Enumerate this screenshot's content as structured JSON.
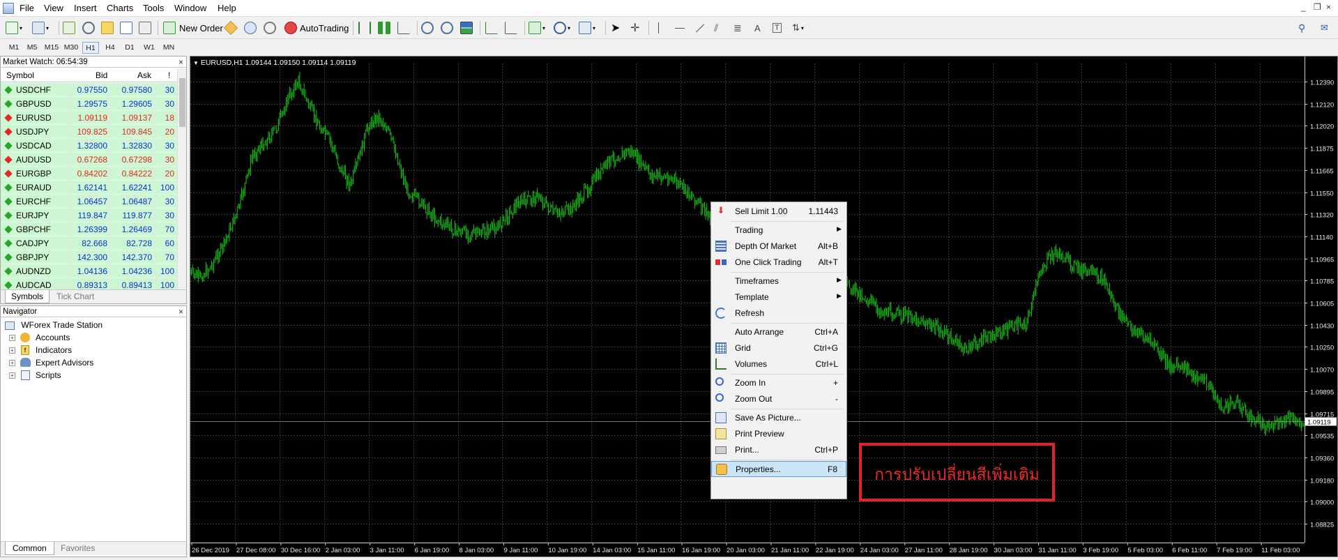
{
  "menubar": {
    "items": [
      "File",
      "View",
      "Insert",
      "Charts",
      "Tools",
      "Window",
      "Help"
    ],
    "window_controls": [
      "_",
      "❐",
      "×"
    ]
  },
  "toolbar": {
    "new_order": "New Order",
    "autotrading": "AutoTrading"
  },
  "timeframes": {
    "items": [
      "M1",
      "M5",
      "M15",
      "M30",
      "H1",
      "H4",
      "D1",
      "W1",
      "MN"
    ],
    "active": "H1"
  },
  "market_watch": {
    "title": "Market Watch: 06:54:39",
    "columns": [
      "Symbol",
      "Bid",
      "Ask",
      "!"
    ],
    "rows": [
      {
        "symbol": "USDCHF",
        "bid": "0.97550",
        "ask": "0.97580",
        "spread": "30",
        "dir": "up"
      },
      {
        "symbol": "GBPUSD",
        "bid": "1.29575",
        "ask": "1.29605",
        "spread": "30",
        "dir": "up"
      },
      {
        "symbol": "EURUSD",
        "bid": "1.09119",
        "ask": "1.09137",
        "spread": "18",
        "dir": "down"
      },
      {
        "symbol": "USDJPY",
        "bid": "109.825",
        "ask": "109.845",
        "spread": "20",
        "dir": "down"
      },
      {
        "symbol": "USDCAD",
        "bid": "1.32800",
        "ask": "1.32830",
        "spread": "30",
        "dir": "up"
      },
      {
        "symbol": "AUDUSD",
        "bid": "0.67268",
        "ask": "0.67298",
        "spread": "30",
        "dir": "down"
      },
      {
        "symbol": "EURGBP",
        "bid": "0.84202",
        "ask": "0.84222",
        "spread": "20",
        "dir": "down"
      },
      {
        "symbol": "EURAUD",
        "bid": "1.62141",
        "ask": "1.62241",
        "spread": "100",
        "dir": "up"
      },
      {
        "symbol": "EURCHF",
        "bid": "1.06457",
        "ask": "1.06487",
        "spread": "30",
        "dir": "up"
      },
      {
        "symbol": "EURJPY",
        "bid": "119.847",
        "ask": "119.877",
        "spread": "30",
        "dir": "up"
      },
      {
        "symbol": "GBPCHF",
        "bid": "1.26399",
        "ask": "1.26469",
        "spread": "70",
        "dir": "up"
      },
      {
        "symbol": "CADJPY",
        "bid": "82.668",
        "ask": "82.728",
        "spread": "60",
        "dir": "up"
      },
      {
        "symbol": "GBPJPY",
        "bid": "142.300",
        "ask": "142.370",
        "spread": "70",
        "dir": "up"
      },
      {
        "symbol": "AUDNZD",
        "bid": "1.04136",
        "ask": "1.04236",
        "spread": "100",
        "dir": "up"
      },
      {
        "symbol": "AUDCAD",
        "bid": "0.89313",
        "ask": "0.89413",
        "spread": "100",
        "dir": "up"
      }
    ],
    "tabs": [
      "Symbols",
      "Tick Chart"
    ]
  },
  "navigator": {
    "title": "Navigator",
    "root": "WForex Trade Station",
    "items": [
      "Accounts",
      "Indicators",
      "Expert Advisors",
      "Scripts"
    ],
    "tabs": [
      "Common",
      "Favorites"
    ]
  },
  "chart": {
    "header": "EURUSD,H1  1.09144 1.09150 1.09114 1.09119",
    "current_price": "1.09119",
    "price_labels": [
      "1.12390",
      "1.12120",
      "1.12020",
      "1.11875",
      "1.11665",
      "1.11550",
      "1.11320",
      "1.11140",
      "1.10965",
      "1.10785",
      "1.10605",
      "1.10430",
      "1.10250",
      "1.10070",
      "1.09895",
      "1.09715",
      "1.09535",
      "1.09360",
      "1.09180",
      "1.09000",
      "1.08825"
    ],
    "time_labels": [
      "26 Dec 2019",
      "27 Dec 08:00",
      "30 Dec 16:00",
      "2 Jan 03:00",
      "3 Jan 11:00",
      "6 Jan 19:00",
      "8 Jan 03:00",
      "9 Jan 11:00",
      "10 Jan 19:00",
      "14 Jan 03:00",
      "15 Jan 11:00",
      "16 Jan 19:00",
      "20 Jan 03:00",
      "21 Jan 11:00",
      "22 Jan 19:00",
      "24 Jan 03:00",
      "27 Jan 11:00",
      "28 Jan 19:00",
      "30 Jan 03:00",
      "31 Jan 11:00",
      "3 Feb 19:00",
      "5 Feb 03:00",
      "6 Feb 11:00",
      "7 Feb 19:00",
      "11 Feb 03:00"
    ],
    "line_color": "#18c718",
    "grid_color": "#3a3a3a"
  },
  "context_menu": {
    "items": [
      {
        "label": "Sell Limit 1.00",
        "shortcut": "1.11443",
        "icon": "sell-limit-arrow-icon"
      },
      {
        "sep": true
      },
      {
        "label": "Trading",
        "submenu": true
      },
      {
        "label": "Depth Of Market",
        "shortcut": "Alt+B",
        "icon": "depth-of-market-icon"
      },
      {
        "label": "One Click Trading",
        "shortcut": "Alt+T",
        "icon": "one-click-trading-icon"
      },
      {
        "sep": true
      },
      {
        "label": "Timeframes",
        "submenu": true
      },
      {
        "label": "Template",
        "submenu": true
      },
      {
        "label": "Refresh",
        "icon": "refresh-icon"
      },
      {
        "sep": true
      },
      {
        "label": "Auto Arrange",
        "shortcut": "Ctrl+A"
      },
      {
        "label": "Grid",
        "shortcut": "Ctrl+G",
        "icon": "grid-icon"
      },
      {
        "label": "Volumes",
        "shortcut": "Ctrl+L",
        "icon": "volumes-icon"
      },
      {
        "sep": true
      },
      {
        "label": "Zoom In",
        "shortcut": "+",
        "icon": "zoom-in-icon"
      },
      {
        "label": "Zoom Out",
        "shortcut": "-",
        "icon": "zoom-out-icon"
      },
      {
        "sep": true
      },
      {
        "label": "Save As Picture...",
        "icon": "save-picture-icon"
      },
      {
        "label": "Print Preview",
        "icon": "print-preview-icon"
      },
      {
        "label": "Print...",
        "shortcut": "Ctrl+P",
        "icon": "printer-icon"
      },
      {
        "sep": true
      },
      {
        "label": "Properties...",
        "shortcut": "F8",
        "icon": "properties-icon",
        "highlighted": true
      }
    ]
  },
  "annotation": {
    "text": "การปรับเปลี่ยนสีเพิ่มเติม",
    "color": "#e22129"
  }
}
